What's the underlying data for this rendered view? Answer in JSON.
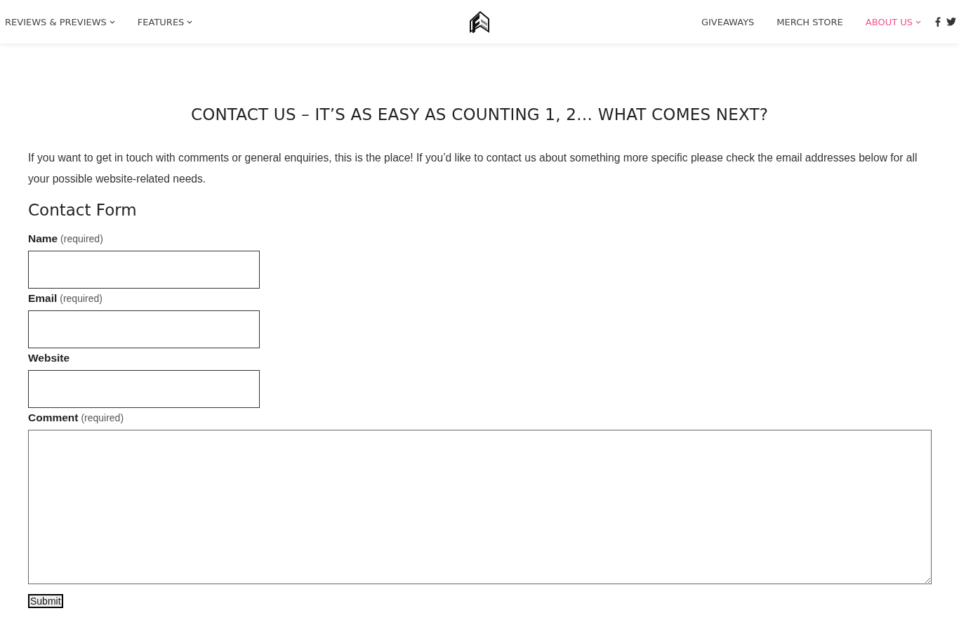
{
  "nav": {
    "left": [
      {
        "label": "REVIEWS & PREVIEWS",
        "dropdown": true,
        "selected": false
      },
      {
        "label": "FEATURES",
        "dropdown": true,
        "selected": false
      }
    ],
    "right": [
      {
        "label": "GIVEAWAYS",
        "dropdown": false,
        "selected": false
      },
      {
        "label": "MERCH STORE",
        "dropdown": false,
        "selected": false
      },
      {
        "label": "ABOUT US",
        "dropdown": true,
        "selected": true
      }
    ],
    "social": [
      {
        "kind": "facebook"
      },
      {
        "kind": "twitter"
      }
    ]
  },
  "title": "CONTACT US – IT’S AS EASY AS COUNTING 1, 2… WHAT COMES NEXT?",
  "intro": "If you want to get in touch with comments or general enquiries, this is the place! If you’d like to contact us about something more specific please check the email addresses below for all your possible website-related needs.",
  "form": {
    "heading": "Contact Form",
    "fields": [
      {
        "label": "Name",
        "note": "(required)",
        "kind": "input"
      },
      {
        "label": "Email",
        "note": "(required)",
        "kind": "input"
      },
      {
        "label": "Website",
        "kind": "input"
      },
      {
        "label": "Comment",
        "note": "(required)",
        "kind": "textarea"
      }
    ],
    "submit": "Submit"
  }
}
